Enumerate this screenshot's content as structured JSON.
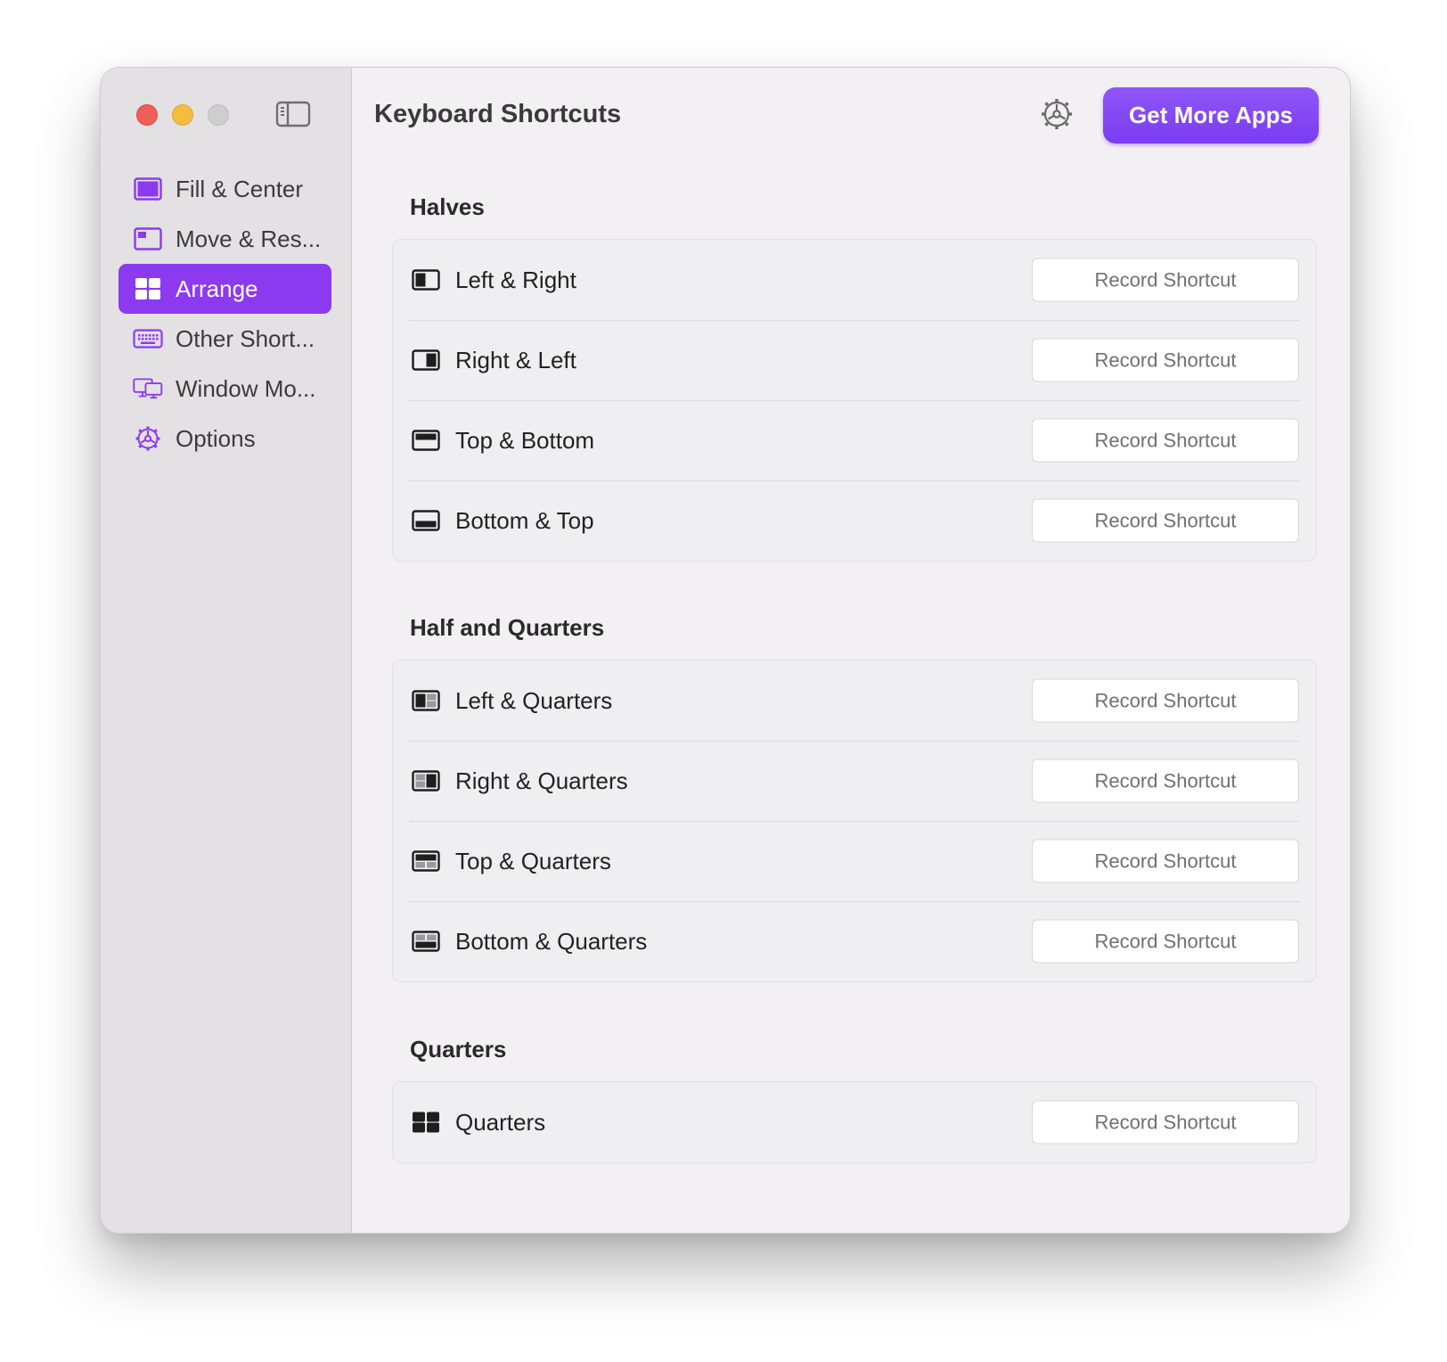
{
  "window": {
    "title": "Keyboard Shortcuts",
    "cta_label": "Get More Apps",
    "accent": "#8c3af0"
  },
  "sidebar": {
    "items": [
      {
        "label": "Fill & Center",
        "icon": "fill-center-icon",
        "active": false
      },
      {
        "label": "Move & Res...",
        "icon": "move-resize-icon",
        "active": false
      },
      {
        "label": "Arrange",
        "icon": "arrange-grid-icon",
        "active": true
      },
      {
        "label": "Other Short...",
        "icon": "keyboard-icon",
        "active": false
      },
      {
        "label": "Window Mo...",
        "icon": "displays-icon",
        "active": false
      },
      {
        "label": "Options",
        "icon": "gear-icon",
        "active": false
      }
    ]
  },
  "sections": [
    {
      "title": "Halves",
      "rows": [
        {
          "label": "Left & Right",
          "icon": "left-half-icon",
          "button": "Record Shortcut"
        },
        {
          "label": "Right & Left",
          "icon": "right-half-icon",
          "button": "Record Shortcut"
        },
        {
          "label": "Top & Bottom",
          "icon": "top-half-icon",
          "button": "Record Shortcut"
        },
        {
          "label": "Bottom & Top",
          "icon": "bottom-half-icon",
          "button": "Record Shortcut"
        }
      ]
    },
    {
      "title": "Half and Quarters",
      "rows": [
        {
          "label": "Left & Quarters",
          "icon": "left-quarters-icon",
          "button": "Record Shortcut"
        },
        {
          "label": "Right & Quarters",
          "icon": "right-quarters-icon",
          "button": "Record Shortcut"
        },
        {
          "label": "Top & Quarters",
          "icon": "top-quarters-icon",
          "button": "Record Shortcut"
        },
        {
          "label": "Bottom & Quarters",
          "icon": "bottom-quarters-icon",
          "button": "Record Shortcut"
        }
      ]
    },
    {
      "title": "Quarters",
      "rows": [
        {
          "label": "Quarters",
          "icon": "quarters-grid-icon",
          "button": "Record Shortcut"
        }
      ]
    }
  ]
}
